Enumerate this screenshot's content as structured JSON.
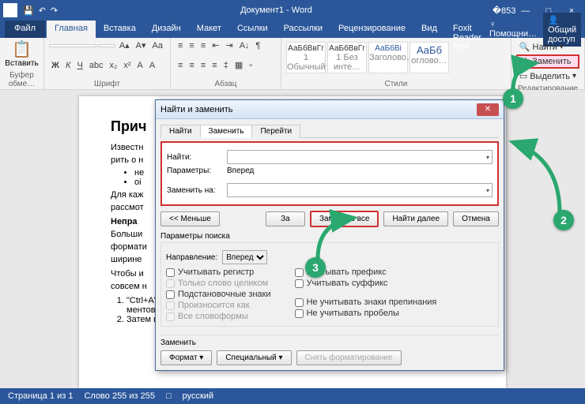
{
  "titlebar": {
    "title": "Документ1 - Word"
  },
  "menu": {
    "file": "Файл",
    "tabs": [
      "Главная",
      "Вставка",
      "Дизайн",
      "Макет",
      "Ссылки",
      "Рассылки",
      "Рецензирование",
      "Вид",
      "Foxit Reader PDF"
    ],
    "active": 0,
    "help": "Помощни…",
    "share": "Общий доступ"
  },
  "ribbon": {
    "paste": "Вставить",
    "clipboard_label": "Буфер обме…",
    "font_label": "Шрифт",
    "para_label": "Абзац",
    "styles_label": "Стили",
    "edit_label": "Редактирование",
    "font_name": "",
    "font_size": "",
    "styles": [
      {
        "preview": "АаБбВвГг",
        "name": "1 Обычный"
      },
      {
        "preview": "АаБбВвГг",
        "name": "1 Без инте…"
      },
      {
        "preview": "АаБбВі",
        "name": "Заголово…"
      },
      {
        "preview": "АаБб",
        "name": "оглово…"
      }
    ],
    "find": "Найти",
    "replace": "Заменить",
    "select": "Выделить"
  },
  "doc": {
    "h1": "Прич",
    "p1": "Известн",
    "p2": "рить о н",
    "li1": "не",
    "li2": "оі",
    "p3": "Для каж",
    "p4": "рассмот",
    "h2": "Непра",
    "p5": "Больши",
    "p6": "формати",
    "p7": "ширине",
    "p8": "Чтобы и",
    "p9": "совсем н",
    "ol1a": "\"Ctrl+A\" или кнопка \"Выделить все\" в группе \"Редактирование\" на панели инстру-",
    "ol1b": "ментов в верхней части Word).",
    "ol2": "Затем используйте сочетание клавиш \"Ctrl+L\" или кнопку \"Выровнять по левому"
  },
  "dialog": {
    "title": "Найти и заменить",
    "tabs": [
      "Найти",
      "Заменить",
      "Перейти"
    ],
    "active": 1,
    "find_label": "Найти:",
    "params_label": "Параметры:",
    "params_value": "Вперед",
    "replace_label": "Заменить на:",
    "btn_less": "<< Меньше",
    "btn_replace": "За",
    "btn_replace_all": "Заменить все",
    "btn_find_next": "Найти далее",
    "btn_cancel": "Отмена",
    "opts_header": "Параметры поиска",
    "direction_label": "Направление:",
    "direction_value": "Вперед",
    "chk_case": "Учитывать регистр",
    "chk_whole": "Только слово целиком",
    "chk_wild": "Подстановочные знаки",
    "chk_sounds": "Произносится как",
    "chk_forms": "Все словоформы",
    "chk_prefix": "Учитывать префикс",
    "chk_suffix": "Учитывать суффикс",
    "chk_punct": "Не учитывать знаки препинания",
    "chk_space": "Не учитывать пробелы",
    "repl_header": "Заменить",
    "btn_format": "Формат ▾",
    "btn_special": "Специальный ▾",
    "btn_nofmt": "Снять форматирование"
  },
  "status": {
    "page": "Страница 1 из 1",
    "words": "Слово 255 из 255",
    "lang": "русский"
  },
  "markers": {
    "m1": "1",
    "m2": "2",
    "m3": "3"
  }
}
